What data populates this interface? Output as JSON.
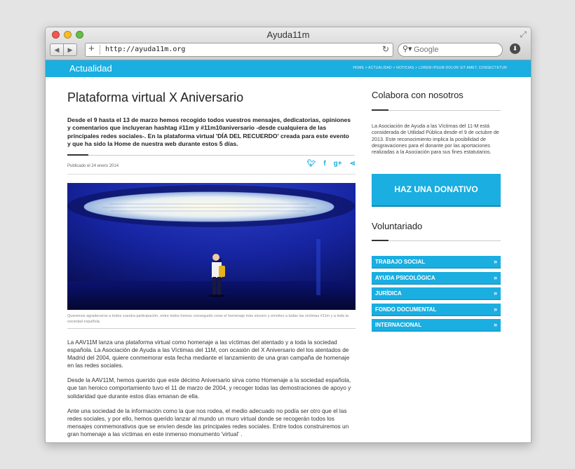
{
  "browser": {
    "title": "Ayuda11m",
    "url": "http://ayuda11m.org",
    "search_placeholder": "Google"
  },
  "site": {
    "section": "Actualidad",
    "breadcrumb": "HOME  >  ACTUALIDAD  >  NOTICIAS  >  LOREM IPSUM DOLOR SIT AMET, CONSECTETUR",
    "brand_color": "#1aaee1"
  },
  "article": {
    "title": "Plataforma virtual X Aniversario",
    "lead": "Desde el 9 hasta el 13 de marzo hemos recogido todos vuestros mensajes, dedicatorias, opiniones y comentarios que incluyeran hashtag #11m y #11m10aniversario -desde cualquiera de las principales redes sociales-. En la plataforma virtual 'DÍA DEL RECUERDO' creada para este evento y que ha sido la Home de nuestra web durante estos 5 días.",
    "published": "Publicado el 24 enero 2014",
    "share_icons": [
      "twitter-icon",
      "facebook-icon",
      "google-plus-icon",
      "share-icon"
    ],
    "image_caption": "Queremos agradeceros a todos vuestra participación, entre todos hemos conseguido crear el homenaje más sincero y emotivo a todas las víctimas #11m y a toda la sociedad española.",
    "paragraphs": [
      "La AAV11M lanza una plataforma virtual como homenaje a las víctimas del atentado y a toda la sociedad española. La Asociación de Ayuda a las Víctimas del 11M, con ocasión del X Aniversario del los atentados de Madrid del 2004, quiere conmemorar esta fecha mediante el lanzamiento de una gran  campaña de homenaje en las redes sociales.",
      "Desde la AAV11M, hemos querido que este décimo Aniversario sirva como Homenaje a la sociedad española, que tan heroico comportamiento tuvo el 11 de marzo de 2004, y recoger todas las demostraciones de apoyo y solidaridad que durante estos días emanan de ella.",
      " Ante una sociedad de la información como la que nos rodea, el medio adecuado no podía ser otro que el las redes sociales, y por ello, hemos querido lanzar al mundo un muro virtual donde se recogerán todos los mensajes conmemorativos que se envíen desde las principales redes sociales. Entre todos construiremos un gran homenaje a las víctimas en este inmenso monumento 'virtual' ."
    ]
  },
  "sidebar": {
    "collab_title": "Colabora con nosotros",
    "collab_text": "La Asociación de Ayuda a las Víctimas del 11-M está considerada de Utilidad Pública desde el 9 de octubre de 2013. Este reconocimiento implica la posibilidad de desgravaciones para el donante por las aportaciones realizadas a la Asociación para sus fines estatutarios.",
    "donate_label": "HAZ UNA DONATIVO",
    "vol_title": "Voluntariado",
    "vol_items": [
      {
        "label": "TRABAJO SOCIAL"
      },
      {
        "label": "AYUDA PSICOLÓGICA"
      },
      {
        "label": "JURÍDICA"
      },
      {
        "label": "FONDO DOCUMENTAL"
      },
      {
        "label": "INTERNACIONAL"
      }
    ]
  }
}
